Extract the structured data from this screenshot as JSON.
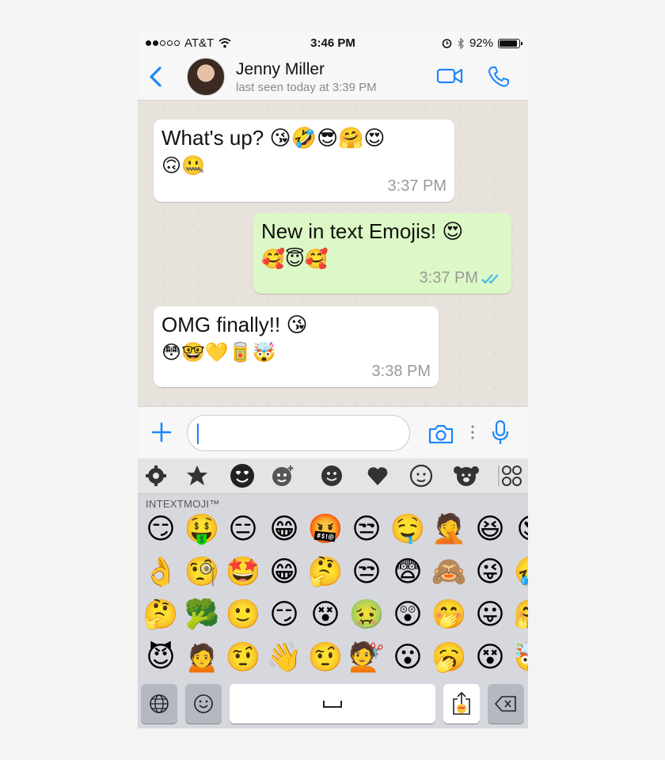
{
  "status_bar": {
    "carrier": "AT&T",
    "signal": "●●○○○",
    "time": "3:46 PM",
    "battery": "92%",
    "battery_level": 0.92
  },
  "header": {
    "back_icon": "chevron-left-icon",
    "contact_name": "Jenny Miller",
    "last_seen": "last seen today at 3:39 PM",
    "actions": [
      "video-call-icon",
      "phone-icon"
    ]
  },
  "messages": [
    {
      "direction": "incoming",
      "text": "What's up? 😘🤣😎🤗😍",
      "emojis": "🙃🤐",
      "time": "3:37 PM"
    },
    {
      "direction": "outgoing",
      "text": "New in text Emojis! 😍",
      "emojis": "🥰😇🥰",
      "time": "3:37 PM",
      "status": "read"
    },
    {
      "direction": "incoming",
      "text": "OMG finally!! 😘",
      "emojis": "😳🤓💛🥫🤯",
      "time": "3:38 PM"
    }
  ],
  "composer": {
    "value": "",
    "icons": [
      "plus-icon",
      "camera-icon",
      "more-icon",
      "microphone-icon"
    ]
  },
  "keyboard": {
    "label": "INTEXTMOJI™",
    "categories": [
      "gear-icon",
      "star-icon",
      "love-face-icon",
      "sparkle-face-icon",
      "smiley-icon",
      "heart-icon",
      "monkey-icon",
      "bear-icon",
      "apps-icon"
    ],
    "active_category": 0,
    "emoji_rows": [
      [
        "😏",
        "🤑",
        "😑",
        "😁",
        "🤬",
        "😒",
        "🤤",
        "🤦",
        "😆",
        "😍"
      ],
      [
        "👌",
        "🧐",
        "🤩",
        "😁",
        "🤔",
        "😒",
        "😨",
        "🙈",
        "😜",
        "🤣"
      ],
      [
        "🤔",
        "🥦",
        "🙂",
        "😏",
        "😵",
        "🤢",
        "😲",
        "🤭",
        "😛",
        "🤗"
      ],
      [
        "😈",
        "🙍",
        "🤨",
        "👋",
        "🤨",
        "💇",
        "😮",
        "🥱",
        "😵",
        "🤯"
      ]
    ],
    "bottom_keys": [
      "globe-icon",
      "smiley-icon",
      "space",
      "share-emoji-icon",
      "backspace-icon"
    ]
  },
  "colors": {
    "accent": "#1f86f7",
    "incoming_bubble": "#ffffff",
    "outgoing_bubble": "#dcf8c6",
    "chat_background": "#e7e3dc",
    "read_ticks": "#34b7f1"
  }
}
